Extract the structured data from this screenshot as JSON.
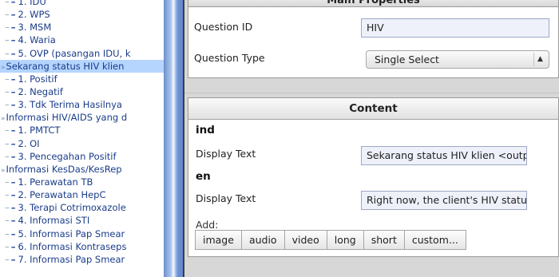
{
  "tree": {
    "items": [
      {
        "text": "1. IDU",
        "level": 1
      },
      {
        "text": "2. WPS",
        "level": 1
      },
      {
        "text": "3. MSM",
        "level": 1
      },
      {
        "text": "4. Waria",
        "level": 1
      },
      {
        "text": "5. OVP (pasangan IDU, k",
        "level": 1
      },
      {
        "text": "Sekarang status HIV klien",
        "level": 0,
        "selected": true
      },
      {
        "text": "1. Positif",
        "level": 1
      },
      {
        "text": "2. Negatif",
        "level": 1
      },
      {
        "text": "3. Tdk Terima Hasilnya",
        "level": 1
      },
      {
        "text": "Informasi HIV/AIDS yang d",
        "level": 0
      },
      {
        "text": "1. PMTCT",
        "level": 1
      },
      {
        "text": "2. OI",
        "level": 1
      },
      {
        "text": "3. Pencegahan Positif",
        "level": 1
      },
      {
        "text": "Informasi KesDas/KesRep",
        "level": 0
      },
      {
        "text": "1. Perawatan TB",
        "level": 1
      },
      {
        "text": "2. Perawatan HepC",
        "level": 1
      },
      {
        "text": "3. Terapi Cotrimoxazole",
        "level": 1
      },
      {
        "text": "4. Informasi STI",
        "level": 1
      },
      {
        "text": "5. Informasi Pap Smear",
        "level": 1
      },
      {
        "text": "6. Informasi Kontraseps",
        "level": 1
      },
      {
        "text": "7. Informasi Pap Smear",
        "level": 1
      }
    ]
  },
  "properties": {
    "header": "Main Properties",
    "question_id_label": "Question ID",
    "question_id_value": "HIV",
    "question_type_label": "Question Type",
    "question_type_value": "Single Select"
  },
  "content": {
    "header": "Content",
    "ind_label": "ind",
    "ind_display_label": "Display Text",
    "ind_display_value": "Sekarang status HIV klien <output",
    "en_label": "en",
    "en_display_label": "Display Text",
    "en_display_value": "Right now, the client's HIV status",
    "add_label": "Add:",
    "buttons": [
      "image",
      "audio",
      "video",
      "long",
      "short",
      "custom..."
    ]
  },
  "colors": {
    "tree_text": "#1a3c8a",
    "selected_row": "#b5d5ff",
    "splitter": "#6c8fc9"
  }
}
